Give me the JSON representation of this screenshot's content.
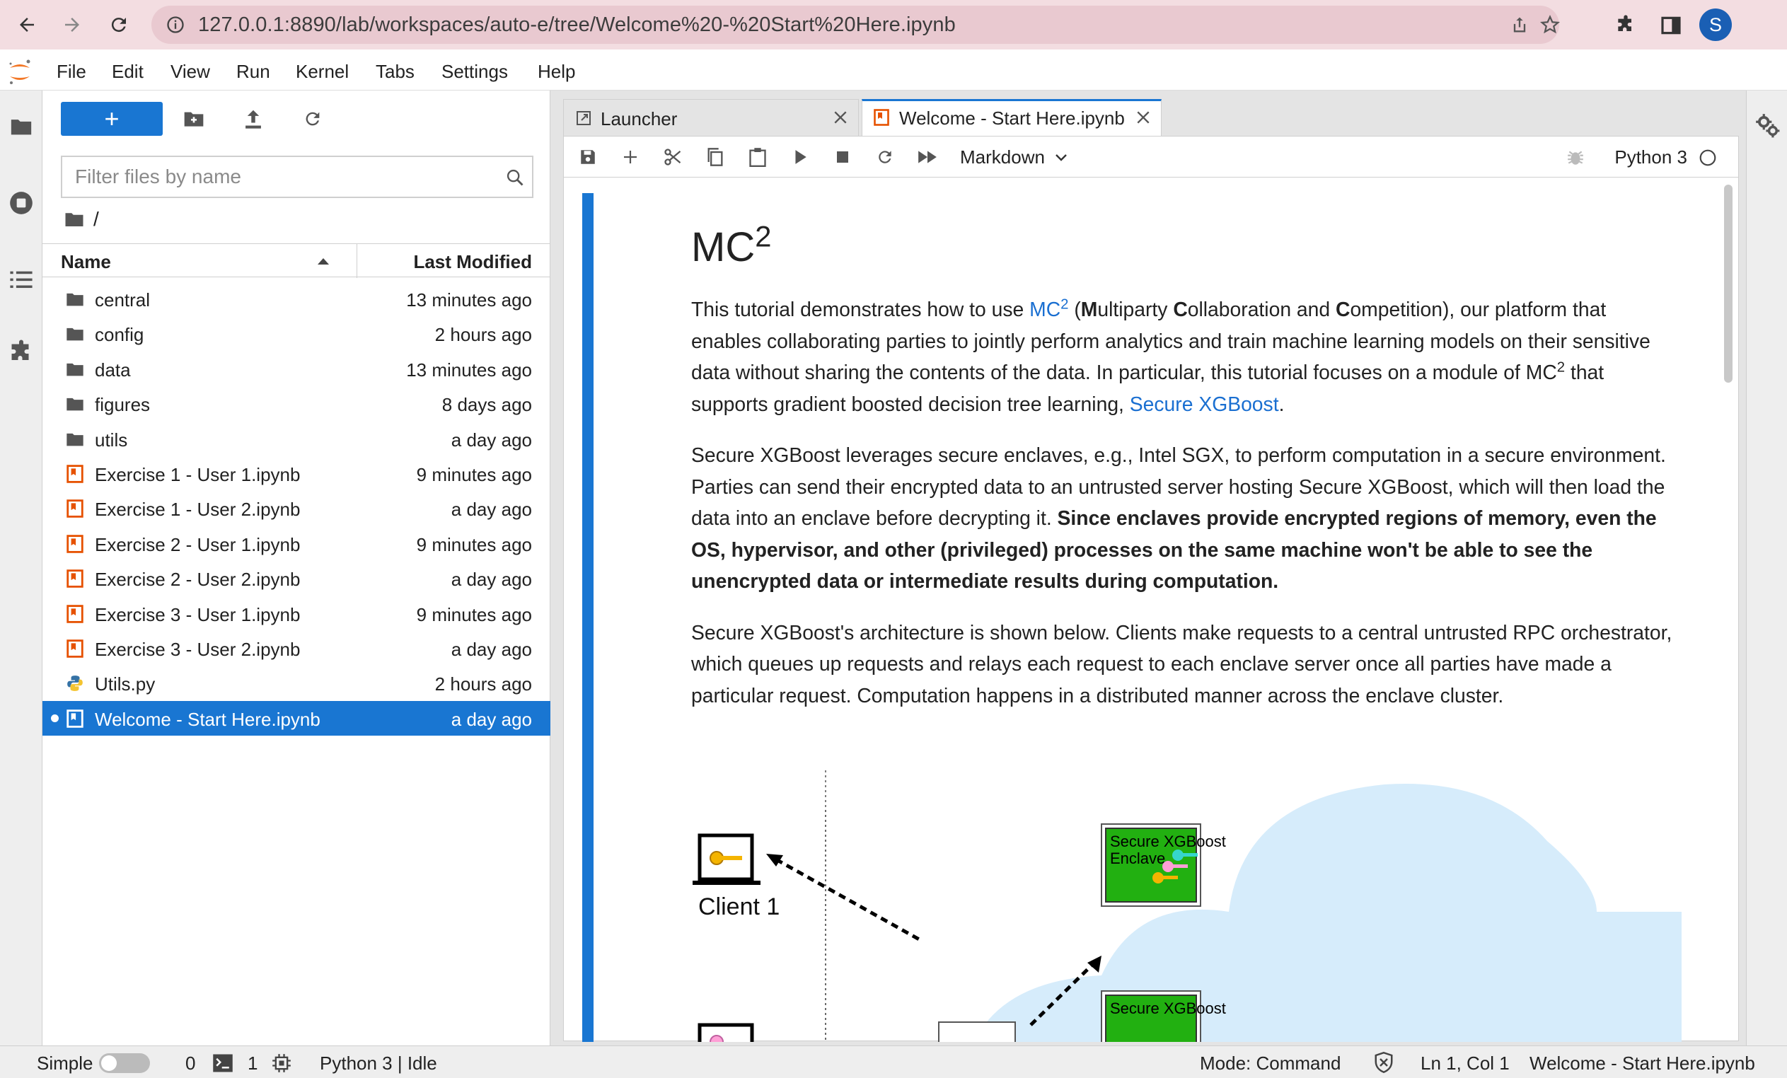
{
  "browser": {
    "url": "127.0.0.1:8890/lab/workspaces/auto-e/tree/Welcome%20-%20Start%20Here.ipynb",
    "avatar_letter": "S"
  },
  "menubar": [
    "File",
    "Edit",
    "View",
    "Run",
    "Kernel",
    "Tabs",
    "Settings",
    "Help"
  ],
  "filebrowser": {
    "new_button": "+",
    "filter_placeholder": "Filter files by name",
    "breadcrumb": "/",
    "columns": {
      "name": "Name",
      "modified": "Last Modified"
    },
    "files": [
      {
        "name": "central",
        "modified": "13 minutes ago",
        "type": "folder"
      },
      {
        "name": "config",
        "modified": "2 hours ago",
        "type": "folder"
      },
      {
        "name": "data",
        "modified": "13 minutes ago",
        "type": "folder"
      },
      {
        "name": "figures",
        "modified": "8 days ago",
        "type": "folder"
      },
      {
        "name": "utils",
        "modified": "a day ago",
        "type": "folder"
      },
      {
        "name": "Exercise 1 - User 1.ipynb",
        "modified": "9 minutes ago",
        "type": "notebook"
      },
      {
        "name": "Exercise 1 - User 2.ipynb",
        "modified": "a day ago",
        "type": "notebook"
      },
      {
        "name": "Exercise 2 - User 1.ipynb",
        "modified": "9 minutes ago",
        "type": "notebook"
      },
      {
        "name": "Exercise 2 - User 2.ipynb",
        "modified": "a day ago",
        "type": "notebook"
      },
      {
        "name": "Exercise 3 - User 1.ipynb",
        "modified": "9 minutes ago",
        "type": "notebook"
      },
      {
        "name": "Exercise 3 - User 2.ipynb",
        "modified": "a day ago",
        "type": "notebook"
      },
      {
        "name": "Utils.py",
        "modified": "2 hours ago",
        "type": "python"
      },
      {
        "name": "Welcome - Start Here.ipynb",
        "modified": "a day ago",
        "type": "notebook",
        "selected": true
      }
    ]
  },
  "tabs": [
    {
      "label": "Launcher",
      "active": false
    },
    {
      "label": "Welcome - Start Here.ipynb",
      "active": true
    }
  ],
  "notebook": {
    "cell_type": "Markdown",
    "kernel": "Python 3",
    "heading": "MC",
    "heading_sup": "2",
    "p1": {
      "t1": "This tutorial demonstrates how to use ",
      "link1": "MC",
      "sup": "2",
      "t2": " (",
      "m": "M",
      "t3": "ultiparty ",
      "c1": "C",
      "t4": "ollaboration and ",
      "c2": "C",
      "t5": "ompetition), our platform that enables collaborating parties to jointly perform analytics and train machine learning models on their sensitive data without sharing the contents of the data. In particular, this tutorial focuses on a module of MC",
      "sup2": "2",
      "t6": " that supports gradient boosted decision tree learning, ",
      "link2": "Secure XGBoost",
      "t7": "."
    },
    "p2": {
      "t1": "Secure XGBoost leverages secure enclaves, e.g., Intel SGX, to perform computation in a secure environment. Parties can send their encrypted data to an untrusted server hosting Secure XGBoost, which will then load the data into an enclave before decrypting it. ",
      "bold": "Since enclaves provide encrypted regions of memory, even the OS, hypervisor, and other (privileged) processes on the same machine won't be able to see the unencrypted data or intermediate results during computation."
    },
    "p3": "Secure XGBoost's architecture is shown below. Clients make requests to a central untrusted RPC orchestrator, which queues up requests and relays each request to each enclave server once all parties have made a particular request. Computation happens in a distributed manner across the enclave cluster.",
    "diagram": {
      "client1": "Client 1",
      "enclave_line1": "Secure XGBoost",
      "enclave_line2": "Enclave"
    }
  },
  "status": {
    "mode_label": "Simple",
    "terminals": "0",
    "kernels": "1",
    "kernel_status": "Python 3 | Idle",
    "mode": "Mode: Command",
    "position": "Ln 1, Col 1",
    "document": "Welcome - Start Here.ipynb"
  },
  "colors": {
    "accent": "#1976d2",
    "chrome": "#f3dde1",
    "notebook_icon": "#e65100",
    "enclave_green": "#22b011",
    "cloud_blue": "#d6ecfb"
  }
}
